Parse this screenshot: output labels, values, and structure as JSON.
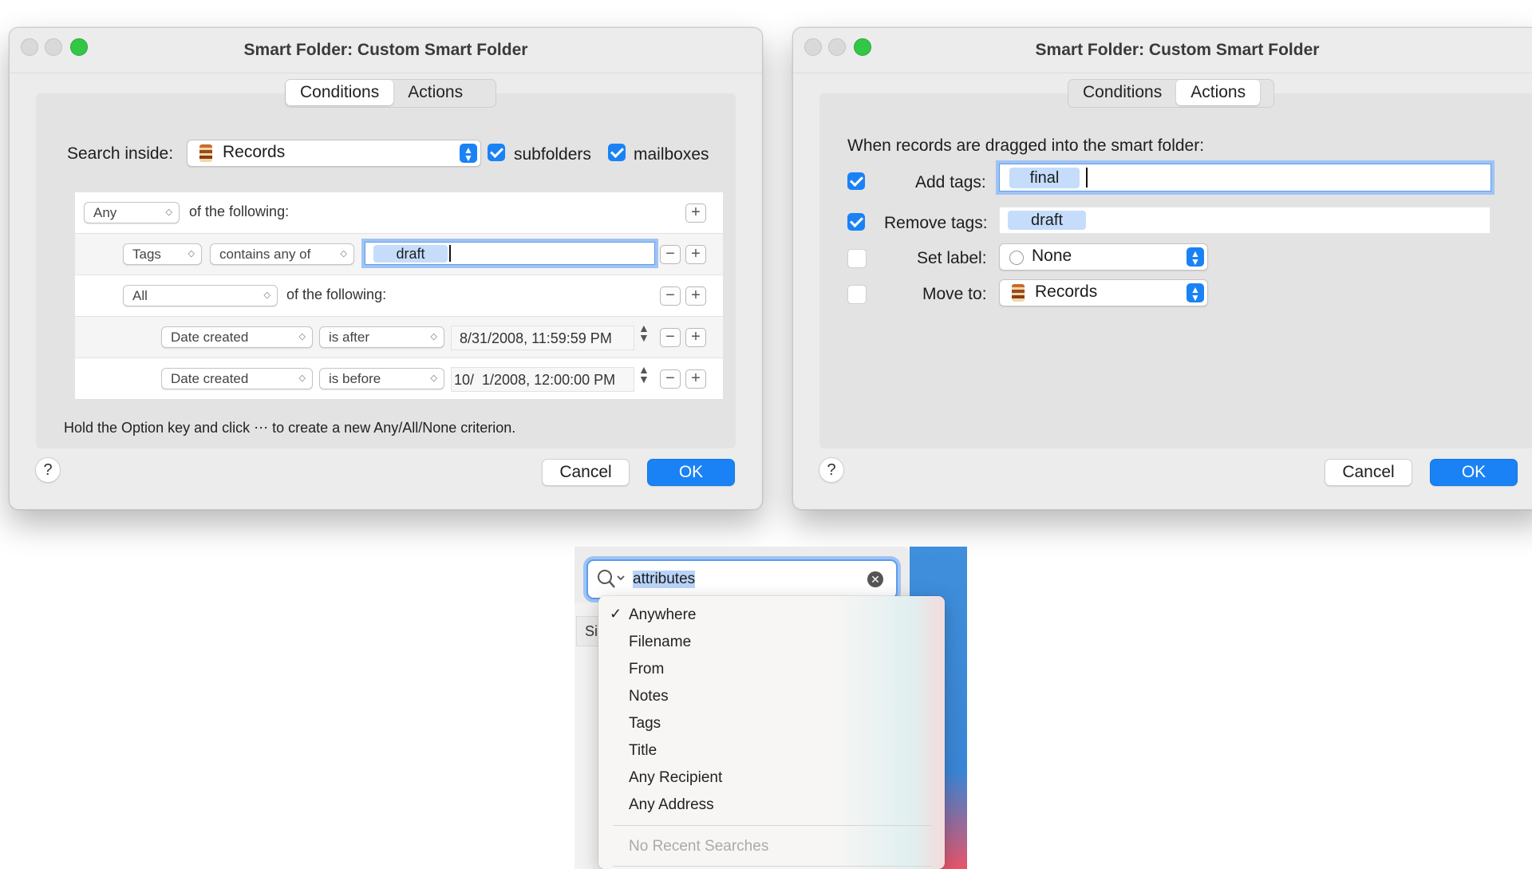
{
  "left_window": {
    "title": "Smart Folder: Custom Smart Folder",
    "tabs": [
      "Conditions",
      "Actions"
    ],
    "active_tab": "Conditions",
    "search_inside_label": "Search inside:",
    "search_inside_value": "Records",
    "subfolders_label": "subfolders",
    "subfolders_checked": true,
    "mailboxes_label": "mailboxes",
    "mailboxes_checked": true,
    "rows": {
      "r1_match": "Any",
      "r1_text": "of the following:",
      "r2_field": "Tags",
      "r2_op": "contains any of",
      "r2_value": "draft",
      "r3_match": "All",
      "r3_text": "of the following:",
      "r4_field": "Date created",
      "r4_op": "is after",
      "r4_value": "8/31/2008, 11:59:59 PM",
      "r5_field": "Date created",
      "r5_op": "is before",
      "r5_value": "10/  1/2008, 12:00:00 PM"
    },
    "hint": "Hold the Option key and click ⋯ to create a new Any/All/None criterion.",
    "help": "?",
    "cancel": "Cancel",
    "ok": "OK"
  },
  "right_window": {
    "title": "Smart Folder: Custom Smart Folder",
    "tabs": [
      "Conditions",
      "Actions"
    ],
    "active_tab": "Actions",
    "intro": "When records are dragged into the smart folder:",
    "add_tags_label": "Add tags:",
    "add_tags_checked": true,
    "add_tags_value": "final",
    "remove_tags_label": "Remove tags:",
    "remove_tags_checked": true,
    "remove_tags_value": "draft",
    "set_label_label": "Set label:",
    "set_label_checked": false,
    "set_label_value": "None",
    "move_to_label": "Move to:",
    "move_to_checked": false,
    "move_to_value": "Records",
    "help": "?",
    "cancel": "Cancel",
    "ok": "OK"
  },
  "search": {
    "query": "attributes",
    "column_fragment": "Si",
    "menu_items": [
      "Anywhere",
      "Filename",
      "From",
      "Notes",
      "Tags",
      "Title",
      "Any Recipient",
      "Any Address"
    ],
    "checked_item": "Anywhere",
    "recent_label": "No Recent Searches"
  },
  "colors": {
    "accent": "#1a82f5",
    "token": "#c5ddfb",
    "window_bg": "#ececec"
  }
}
